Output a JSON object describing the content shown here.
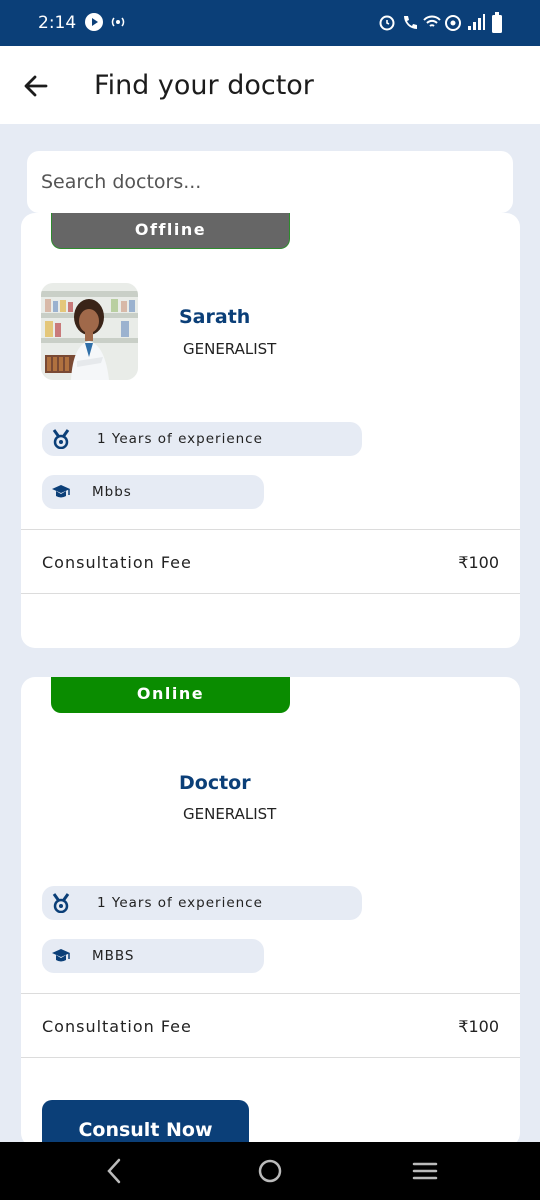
{
  "statusbar": {
    "time": "2:14"
  },
  "appbar": {
    "title": "Find your doctor"
  },
  "search": {
    "placeholder": "Search doctors..."
  },
  "doctors": [
    {
      "status": "Offline",
      "name": "Sarath",
      "specialty": "GENERALIST",
      "experience": "1 Years of experience",
      "qualification": "Mbbs",
      "fee_label": "Consultation Fee",
      "fee": "₹100"
    },
    {
      "status": "Online",
      "name": "Doctor",
      "specialty": "GENERALIST",
      "experience": "1 Years of experience",
      "qualification": "MBBS",
      "fee_label": "Consultation Fee",
      "fee": "₹100",
      "action_label": "Consult Now"
    }
  ],
  "colors": {
    "primary": "#0b3f78",
    "online": "#0a8c00",
    "offline": "#666666",
    "background": "#e6ebf4"
  },
  "icons": {
    "experience": "medal-icon",
    "qualification": "graduation-cap-icon"
  }
}
